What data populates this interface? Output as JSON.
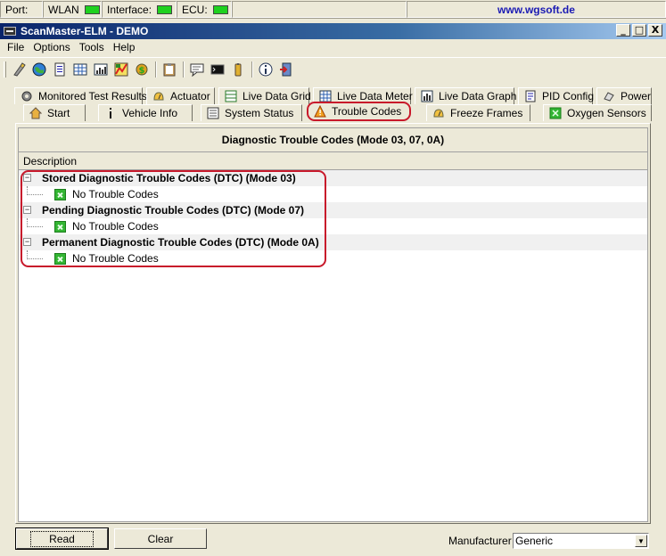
{
  "status": {
    "port_label": "Port:",
    "wlan_label": "WLAN",
    "interface_label": "Interface:",
    "ecu_label": "ECU:",
    "url": "www.wgsoft.de",
    "led_color": "#1fd11f"
  },
  "window": {
    "title": "ScanMaster-ELM - DEMO",
    "buttons": [
      "_",
      "□",
      "X"
    ]
  },
  "menu": [
    "File",
    "Options",
    "Tools",
    "Help"
  ],
  "toolbar": {
    "icons": [
      "sensor-icon",
      "globe-icon",
      "document-icon",
      "grid-icon",
      "meter-icon",
      "graph-icon",
      "money-icon",
      "clipboard-icon",
      "chat-icon",
      "terminal-icon",
      "battery-icon",
      "info-icon",
      "exit-icon"
    ]
  },
  "tabs": {
    "row1": [
      "Monitored Test Results",
      "Actuator",
      "Live Data Grid",
      "Live Data Meter",
      "Live Data Graph",
      "PID Config",
      "Power"
    ],
    "row2": [
      "Start",
      "Vehicle Info",
      "System Status",
      "Trouble Codes",
      "Freeze Frames",
      "Oxygen Sensors"
    ],
    "active": "Trouble Codes",
    "highlight_color": "#c8192b"
  },
  "grid": {
    "title": "Diagnostic Trouble Codes (Mode 03, 07, 0A)",
    "column_header": "Description",
    "groups": [
      {
        "label": "Stored Diagnostic Trouble Codes (DTC) (Mode 03)",
        "items": [
          "No Trouble Codes"
        ]
      },
      {
        "label": "Pending Diagnostic Trouble Codes (DTC) (Mode 07)",
        "items": [
          "No Trouble Codes"
        ]
      },
      {
        "label": "Permanent Diagnostic Trouble Codes (DTC) (Mode 0A)",
        "items": [
          "No Trouble Codes"
        ]
      }
    ]
  },
  "bottom": {
    "read_label": "Read",
    "clear_label": "Clear",
    "manufacturer_label": "Manufacturer",
    "manufacturer_value": "Generic"
  }
}
